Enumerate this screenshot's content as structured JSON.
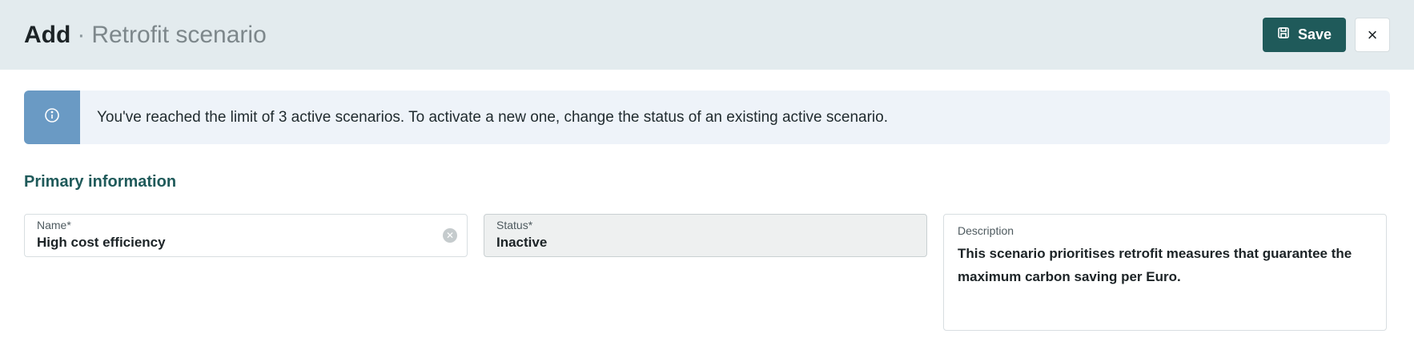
{
  "header": {
    "title_main": "Add",
    "separator": "·",
    "title_sub": "Retrofit scenario",
    "save_label": "Save",
    "close_label": "×"
  },
  "alert": {
    "message": "You've reached the limit of 3 active scenarios. To activate a new one, change the status of an existing active scenario.",
    "icon": "info-icon"
  },
  "section": {
    "title": "Primary information"
  },
  "fields": {
    "name": {
      "label": "Name*",
      "value": "High cost efficiency"
    },
    "status": {
      "label": "Status*",
      "value": "Inactive"
    },
    "description": {
      "label": "Description",
      "value": "This scenario prioritises retrofit measures that guarantee the maximum carbon saving per Euro."
    }
  },
  "colors": {
    "header_bg": "#e3ebee",
    "primary": "#1f5a5a",
    "alert_icon_bg": "#6a9ac4",
    "alert_bg": "#eef3f9"
  }
}
